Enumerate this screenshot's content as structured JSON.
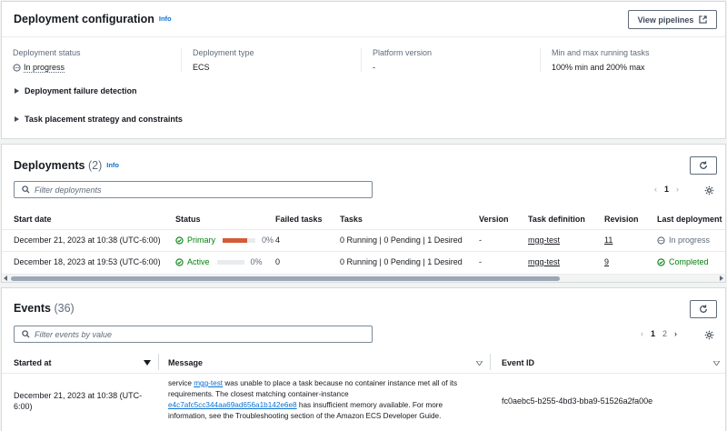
{
  "config": {
    "title": "Deployment configuration",
    "info": "Info",
    "view_pipelines": "View pipelines",
    "fields": [
      {
        "key": "Deployment status",
        "value": "In progress"
      },
      {
        "key": "Deployment type",
        "value": "ECS"
      },
      {
        "key": "Platform version",
        "value": "-"
      },
      {
        "key": "Min and max running tasks",
        "value": "100% min and 200% max"
      }
    ],
    "expanders": [
      "Deployment failure detection",
      "Task placement strategy and constraints"
    ]
  },
  "deployments": {
    "title": "Deployments",
    "count": "(2)",
    "info": "Info",
    "search_placeholder": "Filter deployments",
    "page": "1",
    "columns": [
      "Start date",
      "Status",
      "Failed tasks",
      "Tasks",
      "Version",
      "Task definition",
      "Revision",
      "Last deployment"
    ],
    "rows": [
      {
        "start": "December 21, 2023 at 10:38 (UTC-6:00)",
        "status": "Primary",
        "progress": 0.75,
        "progress_color": "#d45b37",
        "pct": "0%",
        "failed": "4",
        "tasks": "0 Running | 0 Pending | 1 Desired",
        "version": "-",
        "taskdef": "mgg-test",
        "revision": "11",
        "last": "In progress"
      },
      {
        "start": "December 18, 2023 at 19:53 (UTC-6:00)",
        "status": "Active",
        "progress": 0.0,
        "progress_color": "#d45b37",
        "pct": "0%",
        "failed": "0",
        "tasks": "0 Running | 0 Pending | 1 Desired",
        "version": "-",
        "taskdef": "mgg-test",
        "revision": "9",
        "last": "Completed"
      }
    ]
  },
  "events": {
    "title": "Events",
    "count": "(36)",
    "search_placeholder": "Filter events by value",
    "pages": [
      "1",
      "2"
    ],
    "columns": [
      "Started at",
      "Message",
      "Event ID"
    ],
    "row": {
      "started": "December 21, 2023 at 10:38 (UTC-6:00)",
      "msg_pre": "service ",
      "msg_link": "mgg-test",
      "msg_mid": " was unable to place a task because no container instance met all of its requirements. The closest matching container-instance ",
      "msg_link2": "e4c7afc5cc344aa69ad656a1b142e6e8",
      "msg_post": " has insufficient memory available. For more information, see the Troubleshooting section of the Amazon ECS Developer Guide.",
      "event_id": "fc0aebc5-b255-4bd3-bba9-51526a2fa00e"
    }
  }
}
